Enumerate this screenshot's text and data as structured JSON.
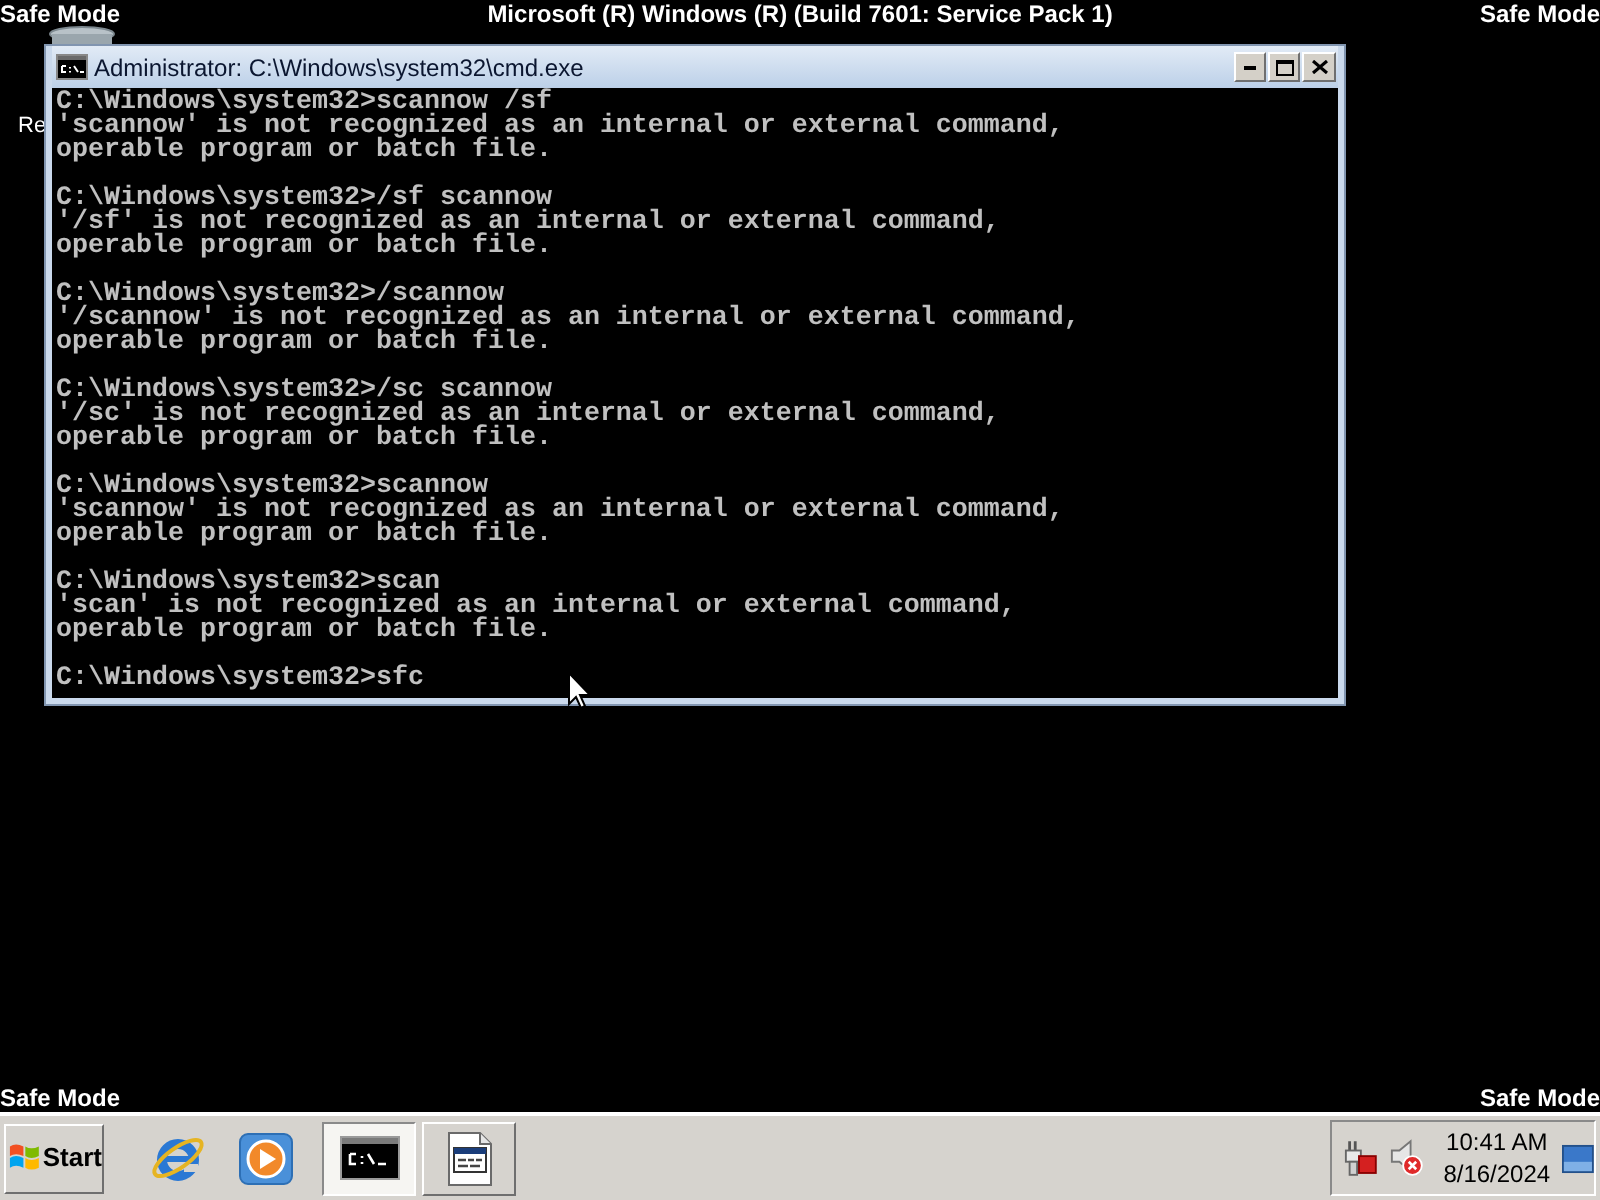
{
  "desktop": {
    "safe_mode_labels": {
      "top_left": "Safe Mode",
      "top_right": "Safe Mode",
      "bottom_left": "Safe Mode",
      "bottom_right": "Safe Mode"
    },
    "build_banner": "Microsoft (R) Windows (R) (Build 7601: Service Pack 1)",
    "icon_label": "Re"
  },
  "window": {
    "title": "Administrator: C:\\Windows\\system32\\cmd.exe"
  },
  "console": {
    "entries": [
      {
        "input": "C:\\Windows\\system32>scannow /sf",
        "output": [
          "'scannow' is not recognized as an internal or external command,",
          "operable program or batch file."
        ]
      },
      {
        "input": "C:\\Windows\\system32>/sf scannow",
        "output": [
          "'/sf' is not recognized as an internal or external command,",
          "operable program or batch file."
        ]
      },
      {
        "input": "C:\\Windows\\system32>/scannow",
        "output": [
          "'/scannow' is not recognized as an internal or external command,",
          "operable program or batch file."
        ]
      },
      {
        "input": "C:\\Windows\\system32>/sc scannow",
        "output": [
          "'/sc' is not recognized as an internal or external command,",
          "operable program or batch file."
        ]
      },
      {
        "input": "C:\\Windows\\system32>scannow",
        "output": [
          "'scannow' is not recognized as an internal or external command,",
          "operable program or batch file."
        ]
      },
      {
        "input": "C:\\Windows\\system32>scan",
        "output": [
          "'scan' is not recognized as an internal or external command,",
          "operable program or batch file."
        ]
      },
      {
        "input": "C:\\Windows\\system32>sfc"
      }
    ]
  },
  "taskbar": {
    "start": "Start",
    "task_buttons": [
      {
        "kind": "console",
        "selected": true
      },
      {
        "kind": "window",
        "selected": false
      }
    ],
    "tray_icons": [
      {
        "kind": "network",
        "error": true
      },
      {
        "kind": "speaker",
        "error": true
      }
    ],
    "time": "10:41 AM",
    "date": "8/16/2024"
  }
}
